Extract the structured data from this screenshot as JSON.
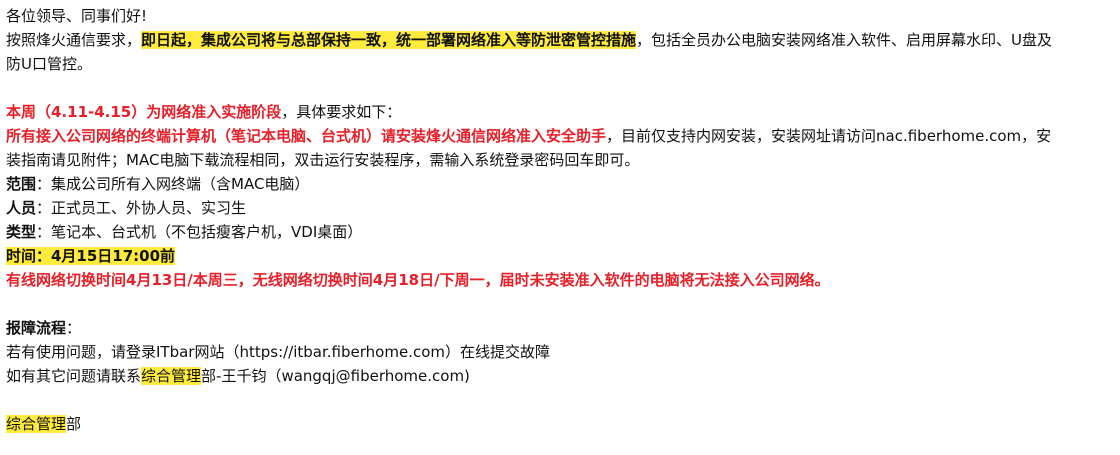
{
  "email": {
    "greeting": "各位领导、同事们好!",
    "intro": {
      "prefix": "按照烽火通信要求，",
      "highlight": "即日起，集成公司将与总部保持一致，统一部署网络准入等防泄密管控措施",
      "suffix": "，包括全员办公电脑安装网络准入软件、启用屏幕水印、U盘及",
      "continuation": "防U口管控。"
    },
    "week": {
      "red": "本周（4.11-4.15）为网络准入实施阶段",
      "rest": "，具体要求如下："
    },
    "requirement": {
      "red": "所有接入公司网络的终端计算机（笔记本电脑、台式机）请安装烽火通信网络准入安全助手",
      "rest": "，目前仅支持内网安装，安装网址请访问nac.fiberhome.com，安",
      "continuation": "装指南请见附件；MAC电脑下载流程相同，双击运行安装程序，需输入系统登录密码回车即可。"
    },
    "scope": {
      "label": "范围",
      "value": "：集成公司所有入网终端（含MAC电脑）"
    },
    "people": {
      "label": "人员",
      "value": "：正式员工、外协人员、实习生"
    },
    "type": {
      "label": "类型",
      "value": "：笔记本、台式机（不包括瘦客户机，VDI桌面）"
    },
    "time": {
      "text": "时间：4月15日17:00前"
    },
    "warning": "有线网络切换时间4月13日/本周三，无线网络切换时间4月18日/下周一，届时未安装准入软件的电脑将无法接入公司网络。",
    "support": {
      "title": "报障流程",
      "colon": "：",
      "line1": "若有使用问题，请登录ITbar网站（https://itbar.fiberhome.com）在线提交故障",
      "line2_prefix": "如有其它问题请联系",
      "line2_highlight": "综合管理",
      "line2_suffix": "部-王千钧（wangqj@fiberhome.com)"
    },
    "signature": {
      "highlight": "综合管理",
      "suffix": "部"
    }
  },
  "colors": {
    "red": "#e8202a",
    "highlight": "#ffeb3b",
    "text": "#111111"
  }
}
